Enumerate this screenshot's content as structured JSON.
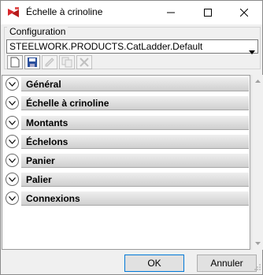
{
  "window": {
    "title": "Échelle à crinoline"
  },
  "configuration": {
    "label": "Configuration",
    "selected": "STEELWORK.PRODUCTS.CatLadder.Default"
  },
  "toolbar": {
    "buttons": [
      "new-icon",
      "save-icon",
      "edit-icon",
      "copy-icon",
      "delete-icon"
    ]
  },
  "sections": [
    {
      "label": "Général"
    },
    {
      "label": "Échelle à crinoline"
    },
    {
      "label": "Montants"
    },
    {
      "label": "Échelons"
    },
    {
      "label": "Panier"
    },
    {
      "label": "Palier"
    },
    {
      "label": "Connexions"
    }
  ],
  "buttons": {
    "ok": "OK",
    "cancel": "Annuler"
  }
}
